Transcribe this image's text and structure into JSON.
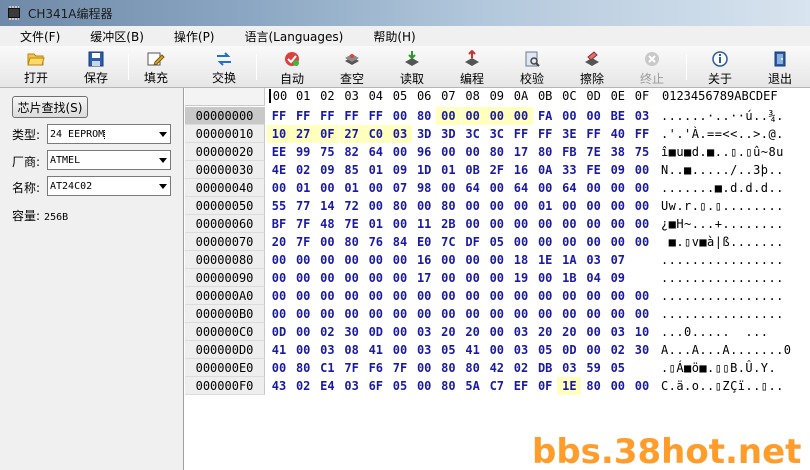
{
  "window": {
    "title": "CH341A编程器"
  },
  "menu": [
    "文件(F)",
    "缓冲区(B)",
    "操作(P)",
    "语言(Languages)",
    "帮助(H)"
  ],
  "toolbar": [
    {
      "label": "打开",
      "icon": "folder-open-icon",
      "enabled": true
    },
    {
      "label": "保存",
      "icon": "floppy-disk-icon",
      "enabled": true
    },
    {
      "label": "填充",
      "icon": "pencil-edit-icon",
      "enabled": true
    },
    {
      "label": "交换",
      "icon": "swap-arrows-icon",
      "enabled": true
    },
    {
      "label": "自动",
      "icon": "auto-chip-icon",
      "enabled": true
    },
    {
      "label": "查空",
      "icon": "blank-check-chip-icon",
      "enabled": true
    },
    {
      "label": "读取",
      "icon": "read-chip-icon",
      "enabled": true
    },
    {
      "label": "编程",
      "icon": "program-chip-icon",
      "enabled": true
    },
    {
      "label": "校验",
      "icon": "verify-chip-icon",
      "enabled": true
    },
    {
      "label": "擦除",
      "icon": "erase-chip-icon",
      "enabled": true
    },
    {
      "label": "终止",
      "icon": "stop-icon",
      "enabled": false
    },
    {
      "label": "关于",
      "icon": "info-icon",
      "enabled": true
    },
    {
      "label": "退出",
      "icon": "exit-icon",
      "enabled": true
    }
  ],
  "left_panel": {
    "search_button": "芯片查找(S)",
    "type_label": "类型:",
    "type_value": "24 EEPROM",
    "vendor_label": "厂商:",
    "vendor_value": "ATMEL",
    "name_label": "名称:",
    "name_value": "AT24C02",
    "capacity_label": "容量:",
    "capacity_value": "256B"
  },
  "hex": {
    "columns": [
      "00",
      "01",
      "02",
      "03",
      "04",
      "05",
      "06",
      "07",
      "08",
      "09",
      "0A",
      "0B",
      "0C",
      "0D",
      "0E",
      "0F"
    ],
    "ascii_header": "0123456789ABCDEF",
    "rows": [
      {
        "addr": "00000000",
        "bytes": [
          "FF",
          "FF",
          "FF",
          "FF",
          "FF",
          "00",
          "80",
          "00",
          "00",
          "00",
          "00",
          "FA",
          "00",
          "00",
          "BE",
          "03"
        ],
        "ascii": "......·..··ú..¾."
      },
      {
        "addr": "00000010",
        "bytes": [
          "10",
          "27",
          "0F",
          "27",
          "C0",
          "03",
          "3D",
          "3D",
          "3C",
          "3C",
          "FF",
          "FF",
          "3E",
          "FF",
          "40",
          "FF"
        ],
        "ascii": ".'.'À.==<<..>.@."
      },
      {
        "addr": "00000020",
        "bytes": [
          "EE",
          "99",
          "75",
          "82",
          "64",
          "00",
          "96",
          "00",
          "00",
          "80",
          "17",
          "80",
          "FB",
          "7E",
          "38",
          "75"
        ],
        "ascii": "î■u■d.■..▯.▯û~8u"
      },
      {
        "addr": "00000030",
        "bytes": [
          "4E",
          "02",
          "09",
          "85",
          "01",
          "09",
          "1D",
          "01",
          "0B",
          "2F",
          "16",
          "0A",
          "33",
          "FE",
          "09",
          "00"
        ],
        "ascii": "N..■...../..3þ.."
      },
      {
        "addr": "00000040",
        "bytes": [
          "00",
          "01",
          "00",
          "01",
          "00",
          "07",
          "98",
          "00",
          "64",
          "00",
          "64",
          "00",
          "64",
          "00",
          "00",
          "00"
        ],
        "ascii": ".......■.d.d.d.."
      },
      {
        "addr": "00000050",
        "bytes": [
          "55",
          "77",
          "14",
          "72",
          "00",
          "80",
          "00",
          "80",
          "00",
          "00",
          "00",
          "01",
          "00",
          "00",
          "00",
          "00"
        ],
        "ascii": "Uw.r.▯.▯........"
      },
      {
        "addr": "00000060",
        "bytes": [
          "BF",
          "7F",
          "48",
          "7E",
          "01",
          "00",
          "11",
          "2B",
          "00",
          "00",
          "00",
          "00",
          "00",
          "00",
          "00",
          "00"
        ],
        "ascii": "¿■H~...+........"
      },
      {
        "addr": "00000070",
        "bytes": [
          "20",
          "7F",
          "00",
          "80",
          "76",
          "84",
          "E0",
          "7C",
          "DF",
          "05",
          "00",
          "00",
          "00",
          "00",
          "00",
          "00"
        ],
        "ascii": " ■.▯v■à|ß......."
      },
      {
        "addr": "00000080",
        "bytes": [
          "00",
          "00",
          "00",
          "00",
          "00",
          "00",
          "16",
          "00",
          "00",
          "00",
          "18",
          "1E",
          "1A",
          "03",
          "07"
        ],
        "ascii": "................"
      },
      {
        "addr": "00000090",
        "bytes": [
          "00",
          "00",
          "00",
          "00",
          "00",
          "00",
          "17",
          "00",
          "00",
          "00",
          "19",
          "00",
          "1B",
          "04",
          "09"
        ],
        "ascii": "................"
      },
      {
        "addr": "000000A0",
        "bytes": [
          "00",
          "00",
          "00",
          "00",
          "00",
          "00",
          "00",
          "00",
          "00",
          "00",
          "00",
          "00",
          "00",
          "00",
          "00",
          "00"
        ],
        "ascii": "................"
      },
      {
        "addr": "000000B0",
        "bytes": [
          "00",
          "00",
          "00",
          "00",
          "00",
          "00",
          "00",
          "00",
          "00",
          "00",
          "00",
          "00",
          "00",
          "00",
          "00",
          "00"
        ],
        "ascii": "................"
      },
      {
        "addr": "000000C0",
        "bytes": [
          "0D",
          "00",
          "02",
          "30",
          "0D",
          "00",
          "03",
          "20",
          "20",
          "00",
          "03",
          "20",
          "20",
          "00",
          "03",
          "10"
        ],
        "ascii": "...0.....  ...  "
      },
      {
        "addr": "000000D0",
        "bytes": [
          "41",
          "00",
          "03",
          "08",
          "41",
          "00",
          "03",
          "05",
          "41",
          "00",
          "03",
          "05",
          "0D",
          "00",
          "02",
          "30"
        ],
        "ascii": "A...A...A.......0"
      },
      {
        "addr": "000000E0",
        "bytes": [
          "00",
          "80",
          "C1",
          "7F",
          "F6",
          "7F",
          "00",
          "80",
          "80",
          "42",
          "02",
          "DB",
          "03",
          "59",
          "05"
        ],
        "ascii": ".▯Á■ö■.▯▯B.Û.Y."
      },
      {
        "addr": "000000F0",
        "bytes": [
          "43",
          "02",
          "E4",
          "03",
          "6F",
          "05",
          "00",
          "80",
          "5A",
          "C7",
          "EF",
          "0F",
          "1E",
          "80",
          "00",
          "00"
        ],
        "ascii": "C.ä.o..▯ZÇï..▯.."
      }
    ]
  },
  "watermark": "bbs.38hot.net",
  "colors": {
    "hex_text": "#1a1aa0",
    "highlight": "#ffffbe",
    "watermark": "#ff9c2a"
  }
}
